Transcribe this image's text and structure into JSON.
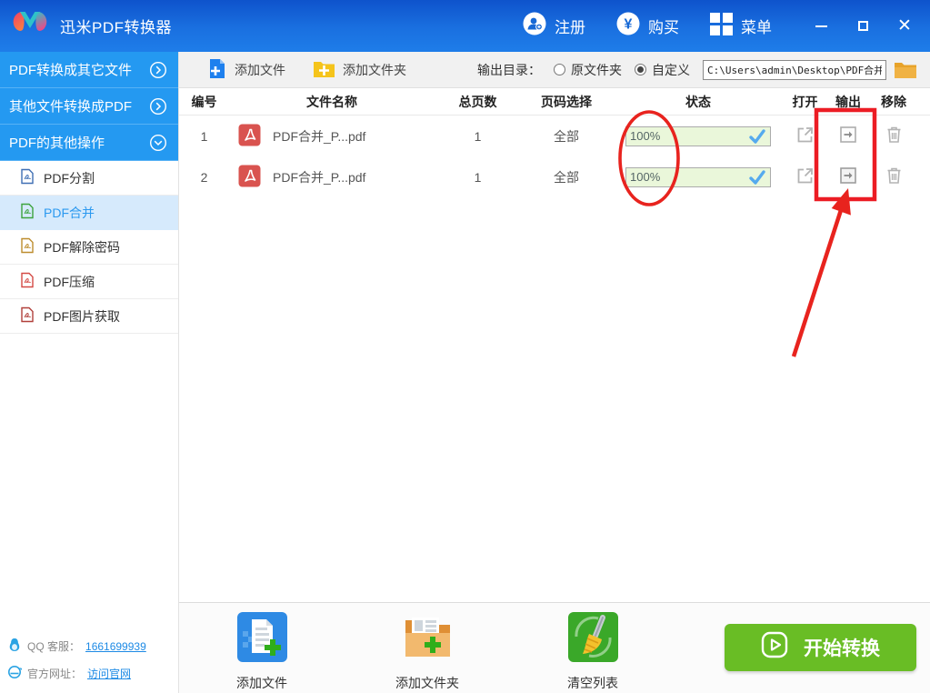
{
  "titlebar": {
    "app_title": "迅米PDF转换器",
    "register_label": "注册",
    "buy_label": "购买",
    "menu_label": "菜单"
  },
  "sidebar": {
    "sections": [
      {
        "label": "PDF转换成其它文件"
      },
      {
        "label": "其他文件转换成PDF"
      },
      {
        "label": "PDF的其他操作"
      }
    ],
    "items": [
      {
        "label": "PDF分割"
      },
      {
        "label": "PDF合并"
      },
      {
        "label": "PDF解除密码"
      },
      {
        "label": "PDF压缩"
      },
      {
        "label": "PDF图片获取"
      }
    ],
    "footer": {
      "qq_label": "QQ 客服：",
      "qq_value": "1661699939",
      "site_label": "官方网址：",
      "site_link": "访问官网"
    }
  },
  "toolbar": {
    "add_file_label": "添加文件",
    "add_folder_label": "添加文件夹",
    "output_dir_label": "输出目录：",
    "radio_source_label": "原文件夹",
    "radio_custom_label": "自定义",
    "output_path": "C:\\Users\\admin\\Desktop\\PDF合并"
  },
  "table": {
    "headers": {
      "no": "编号",
      "name": "文件名称",
      "pages": "总页数",
      "range": "页码选择",
      "status": "状态",
      "open": "打开",
      "output": "输出",
      "remove": "移除"
    },
    "rows": [
      {
        "no": "1",
        "name": "PDF合并_P...pdf",
        "pages": "1",
        "range": "全部",
        "progress": "100%"
      },
      {
        "no": "2",
        "name": "PDF合并_P...pdf",
        "pages": "1",
        "range": "全部",
        "progress": "100%"
      }
    ]
  },
  "bottombar": {
    "add_file_label": "添加文件",
    "add_folder_label": "添加文件夹",
    "clear_list_label": "清空列表",
    "start_label": "开始转换"
  },
  "colors": {
    "accent_blue": "#2499f1",
    "titlebar_blue": "#1a70e0",
    "start_green": "#69bd25",
    "annotation_red": "#e8231e",
    "progress_green": "#eaf7da"
  }
}
